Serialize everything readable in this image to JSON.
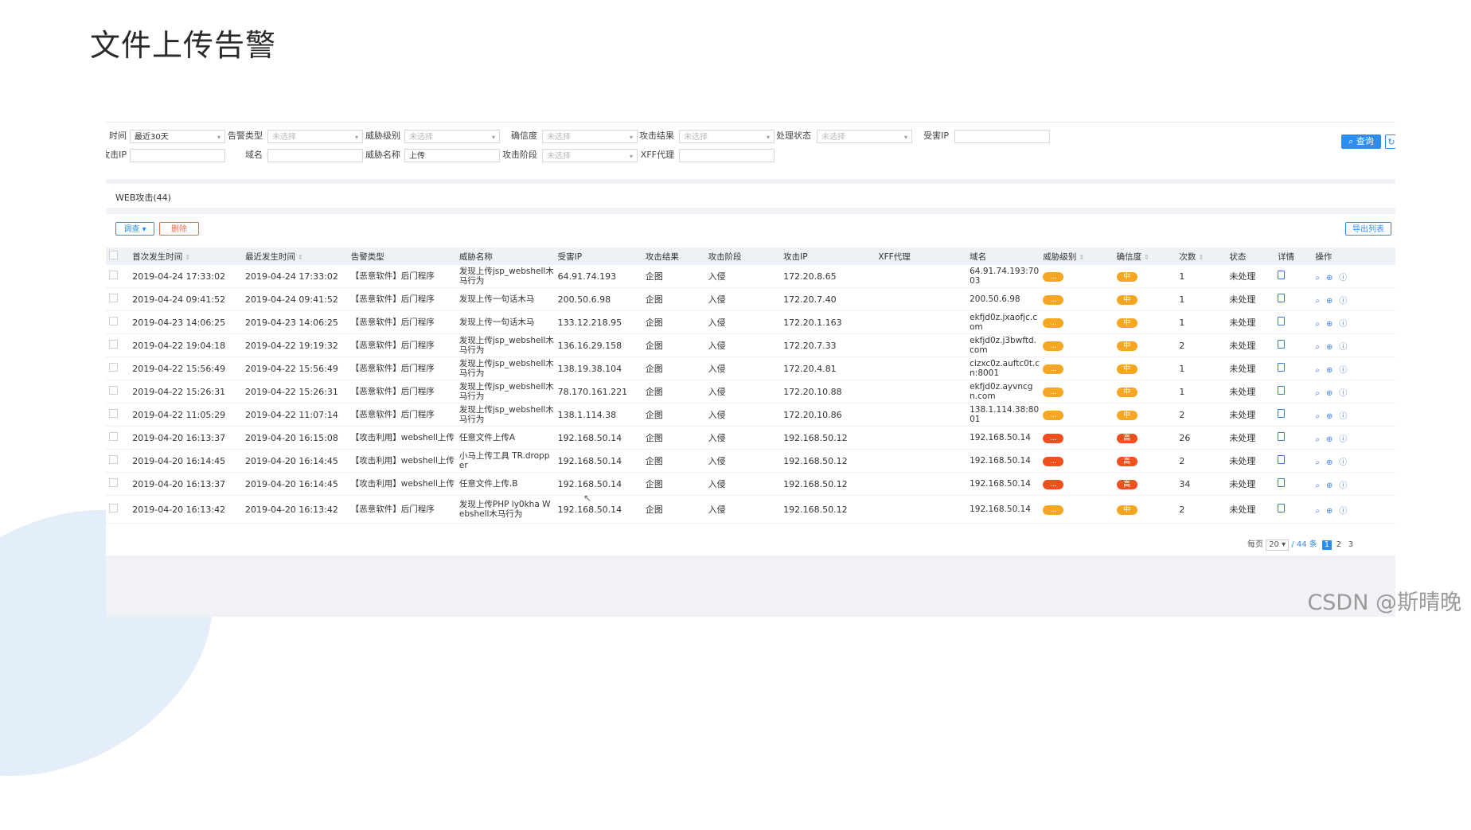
{
  "slide": {
    "title": "文件上传告警",
    "watermark": "CSDN @斯晴晚"
  },
  "filters": {
    "time_label": "时间",
    "time_value": "最近30天",
    "alert_type_label": "告警类型",
    "alert_type_placeholder": "未选择",
    "threat_level_label": "威胁级别",
    "threat_level_placeholder": "未选择",
    "confidence_label": "确信度",
    "confidence_placeholder": "未选择",
    "attack_result_label": "攻击结果",
    "attack_result_placeholder": "未选择",
    "status_label": "处理状态",
    "status_placeholder": "未选择",
    "victim_ip_label": "受害IP",
    "victim_ip_value": "",
    "attacker_ip_label": "攻击IP",
    "attacker_ip_value": "",
    "domain_label": "域名",
    "domain_value": "",
    "threat_name_label": "威胁名称",
    "threat_name_value": "上传",
    "attack_stage_label": "攻击阶段",
    "attack_stage_placeholder": "未选择",
    "xff_label": "XFF代理",
    "xff_value": "",
    "query_button": "查询",
    "refresh_icon": "refresh-icon"
  },
  "tab": {
    "label": "WEB攻击(44)"
  },
  "toolbar": {
    "survey_label": "调查",
    "delete_label": "删除",
    "export_label": "导出列表"
  },
  "table": {
    "headers": {
      "first_time": "首次发生时间",
      "last_time": "最近发生时间",
      "alert_type": "告警类型",
      "threat_name": "威胁名称",
      "victim_ip": "受害IP",
      "attack_result": "攻击结果",
      "attack_stage": "攻击阶段",
      "attacker_ip": "攻击IP",
      "xff": "XFF代理",
      "domain": "域名",
      "threat_level": "威胁级别",
      "confidence": "确信度",
      "count": "次数",
      "status": "状态",
      "detail": "详情",
      "action": "操作"
    },
    "rows": [
      {
        "first": "2019-04-24 17:33:02",
        "last": "2019-04-24 17:33:02",
        "type": "【恶意软件】后门程序",
        "name": "发现上传jsp_webshell木马行为",
        "victim": "64.91.74.193",
        "result": "企图",
        "stage": "入侵",
        "attacker": "172.20.8.65",
        "xff": "",
        "domain": "64.91.74.193:7003",
        "level": "...",
        "level_color": "orange",
        "conf": "中",
        "conf_color": "orange",
        "count": "1",
        "status": "未处理"
      },
      {
        "first": "2019-04-24 09:41:52",
        "last": "2019-04-24 09:41:52",
        "type": "【恶意软件】后门程序",
        "name": "发现上传一句话木马",
        "victim": "200.50.6.98",
        "result": "企图",
        "stage": "入侵",
        "attacker": "172.20.7.40",
        "xff": "",
        "domain": "200.50.6.98",
        "level": "...",
        "level_color": "orange",
        "conf": "中",
        "conf_color": "orange",
        "count": "1",
        "status": "未处理"
      },
      {
        "first": "2019-04-23 14:06:25",
        "last": "2019-04-23 14:06:25",
        "type": "【恶意软件】后门程序",
        "name": "发现上传一句话木马",
        "victim": "133.12.218.95",
        "result": "企图",
        "stage": "入侵",
        "attacker": "172.20.1.163",
        "xff": "",
        "domain": "ekfjd0z.jxaofjc.com",
        "level": "...",
        "level_color": "orange",
        "conf": "中",
        "conf_color": "orange",
        "count": "1",
        "status": "未处理"
      },
      {
        "first": "2019-04-22 19:04:18",
        "last": "2019-04-22 19:19:32",
        "type": "【恶意软件】后门程序",
        "name": "发现上传jsp_webshell木马行为",
        "victim": "136.16.29.158",
        "result": "企图",
        "stage": "入侵",
        "attacker": "172.20.7.33",
        "xff": "",
        "domain": "ekfjd0z.j3bwftd.com",
        "level": "...",
        "level_color": "orange",
        "conf": "中",
        "conf_color": "orange",
        "count": "2",
        "status": "未处理"
      },
      {
        "first": "2019-04-22 15:56:49",
        "last": "2019-04-22 15:56:49",
        "type": "【恶意软件】后门程序",
        "name": "发现上传jsp_webshell木马行为",
        "victim": "138.19.38.104",
        "result": "企图",
        "stage": "入侵",
        "attacker": "172.20.4.81",
        "xff": "",
        "domain": "cizxc0z.auftc0t.cn:8001",
        "level": "...",
        "level_color": "orange",
        "conf": "中",
        "conf_color": "orange",
        "count": "1",
        "status": "未处理"
      },
      {
        "first": "2019-04-22 15:26:31",
        "last": "2019-04-22 15:26:31",
        "type": "【恶意软件】后门程序",
        "name": "发现上传jsp_webshell木马行为",
        "victim": "78.170.161.221",
        "result": "企图",
        "stage": "入侵",
        "attacker": "172.20.10.88",
        "xff": "",
        "domain": "ekfjd0z.ayvncgn.com",
        "level": "...",
        "level_color": "orange",
        "conf": "中",
        "conf_color": "orange",
        "count": "1",
        "status": "未处理"
      },
      {
        "first": "2019-04-22 11:05:29",
        "last": "2019-04-22 11:07:14",
        "type": "【恶意软件】后门程序",
        "name": "发现上传jsp_webshell木马行为",
        "victim": "138.1.114.38",
        "result": "企图",
        "stage": "入侵",
        "attacker": "172.20.10.86",
        "xff": "",
        "domain": "138.1.114.38:8001",
        "level": "...",
        "level_color": "orange",
        "conf": "中",
        "conf_color": "orange",
        "count": "2",
        "status": "未处理"
      },
      {
        "first": "2019-04-20 16:13:37",
        "last": "2019-04-20 16:15:08",
        "type": "【攻击利用】webshell上传",
        "name": "任意文件上传A",
        "victim": "192.168.50.14",
        "result": "企图",
        "stage": "入侵",
        "attacker": "192.168.50.12",
        "xff": "",
        "domain": "192.168.50.14",
        "level": "...",
        "level_color": "red",
        "conf": "高",
        "conf_color": "red",
        "count": "26",
        "status": "未处理"
      },
      {
        "first": "2019-04-20 16:14:45",
        "last": "2019-04-20 16:14:45",
        "type": "【攻击利用】webshell上传",
        "name": "小马上传工具 TR.dropper",
        "victim": "192.168.50.14",
        "result": "企图",
        "stage": "入侵",
        "attacker": "192.168.50.12",
        "xff": "",
        "domain": "192.168.50.14",
        "level": "...",
        "level_color": "red",
        "conf": "高",
        "conf_color": "red",
        "count": "2",
        "status": "未处理"
      },
      {
        "first": "2019-04-20 16:13:37",
        "last": "2019-04-20 16:14:45",
        "type": "【攻击利用】webshell上传",
        "name": "任意文件上传.B",
        "victim": "192.168.50.14",
        "result": "企图",
        "stage": "入侵",
        "attacker": "192.168.50.12",
        "xff": "",
        "domain": "192.168.50.14",
        "level": "...",
        "level_color": "red",
        "conf": "高",
        "conf_color": "red",
        "count": "34",
        "status": "未处理"
      },
      {
        "first": "2019-04-20 16:13:42",
        "last": "2019-04-20 16:13:42",
        "type": "【恶意软件】后门程序",
        "name": "发现上传PHP ly0kha Webshell木马行为",
        "victim": "192.168.50.14",
        "result": "企图",
        "stage": "入侵",
        "attacker": "192.168.50.12",
        "xff": "",
        "domain": "192.168.50.14",
        "level": "...",
        "level_color": "orange",
        "conf": "中",
        "conf_color": "orange",
        "count": "2",
        "status": "未处理"
      }
    ]
  },
  "pagination": {
    "per_page_label": "每页",
    "per_page_value": "20",
    "total": "/ 44 条",
    "pages": [
      "1",
      "2",
      "3"
    ],
    "current": "1"
  },
  "colors": {
    "primary": "#2d8cf0",
    "danger": "#e8684a",
    "orange": "#f5a623",
    "red": "#f0501e"
  }
}
